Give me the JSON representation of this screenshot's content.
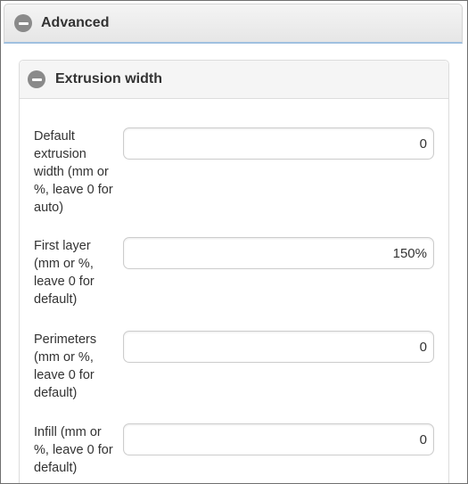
{
  "advanced": {
    "title": "Advanced"
  },
  "extrusion_width": {
    "title": "Extrusion width",
    "fields": [
      {
        "label": "Default extrusion width (mm or %, leave 0 for auto)",
        "value": "0"
      },
      {
        "label": "First layer (mm or %, leave 0 for default)",
        "value": "150%"
      },
      {
        "label": "Perimeters (mm or %, leave 0 for default)",
        "value": "0"
      },
      {
        "label": "Infill (mm or %, leave 0 for default)",
        "value": "0"
      }
    ]
  }
}
